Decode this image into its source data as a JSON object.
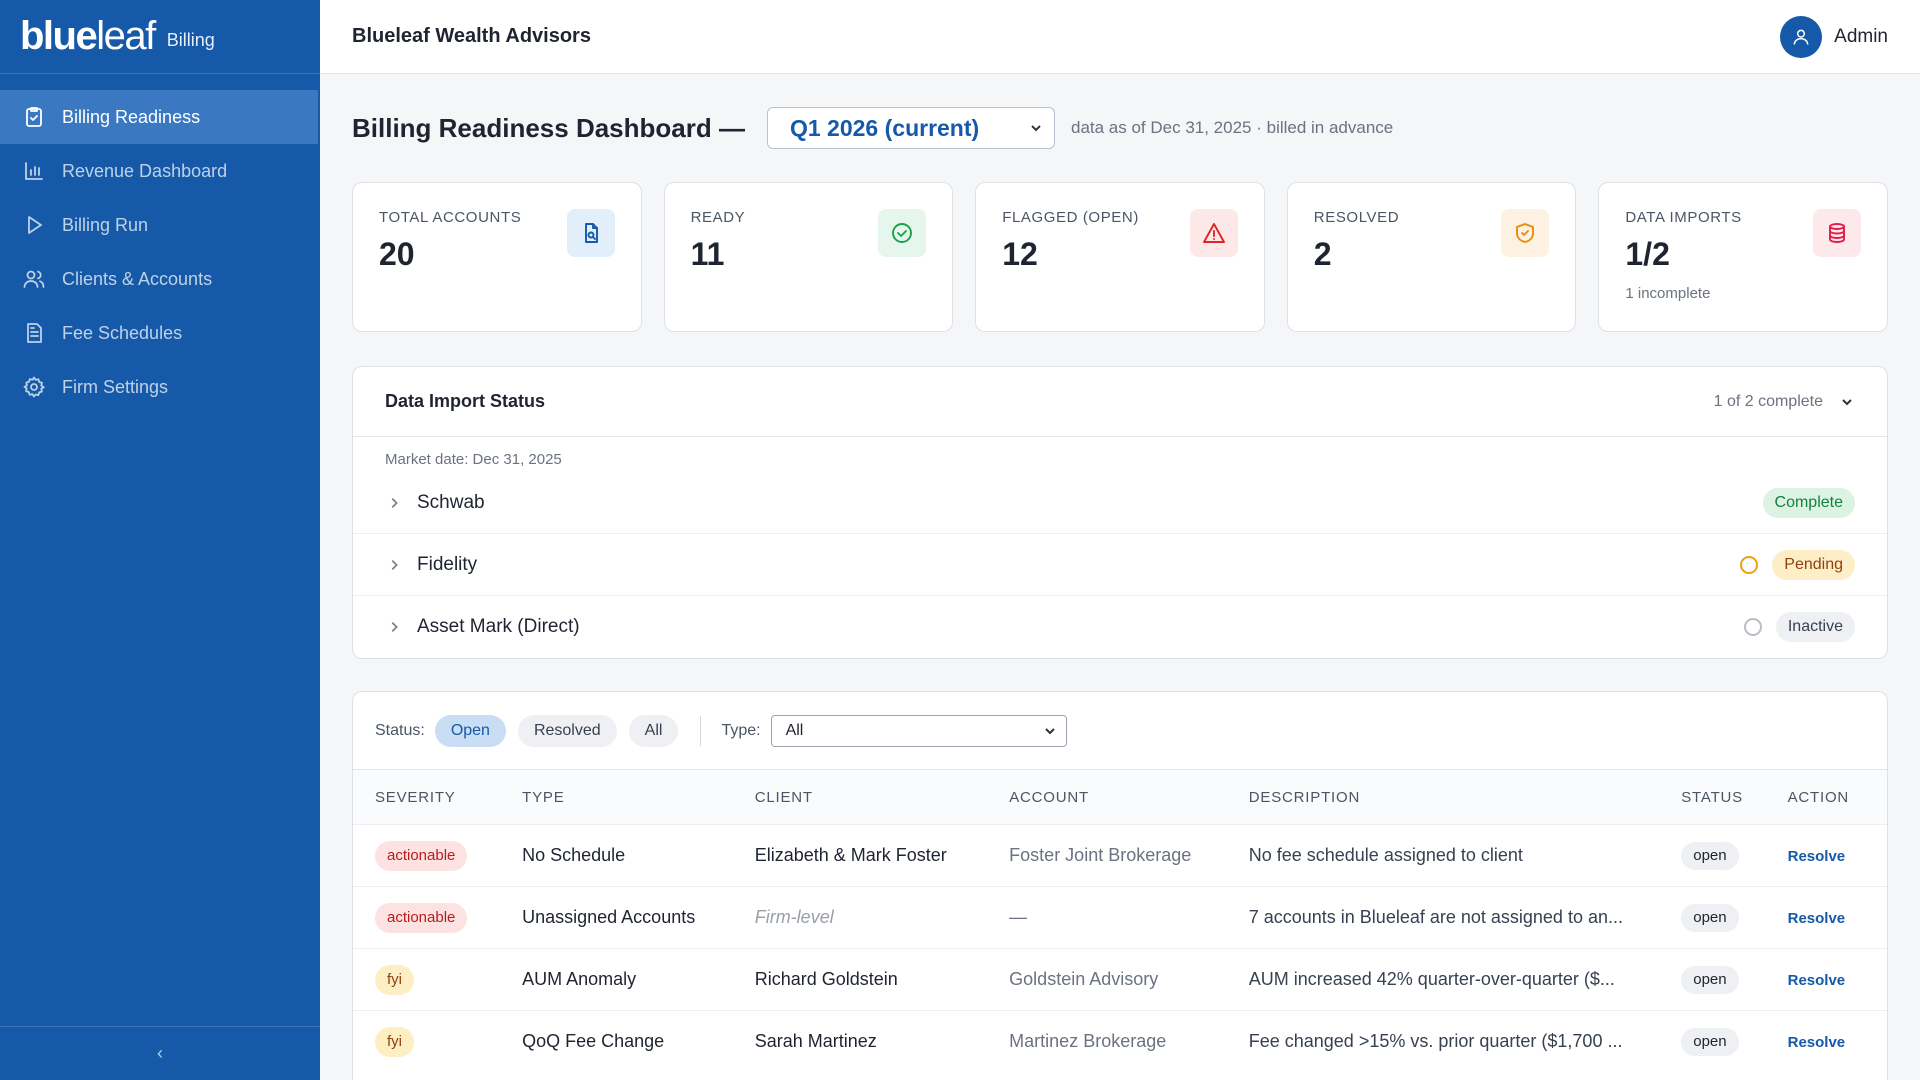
{
  "brand": {
    "logo_text_bold": "blue",
    "logo_text_light": "leaf",
    "product": "Billing"
  },
  "sidebar": {
    "items": [
      {
        "label": "Billing Readiness",
        "icon": "clipboard-check-icon",
        "active": true
      },
      {
        "label": "Revenue Dashboard",
        "icon": "bar-chart-icon",
        "active": false
      },
      {
        "label": "Billing Run",
        "icon": "play-icon",
        "active": false
      },
      {
        "label": "Clients & Accounts",
        "icon": "users-icon",
        "active": false
      },
      {
        "label": "Fee Schedules",
        "icon": "document-icon",
        "active": false
      },
      {
        "label": "Firm Settings",
        "icon": "gear-icon",
        "active": false
      }
    ],
    "collapse_glyph": "‹"
  },
  "header": {
    "firm_name": "Blueleaf Wealth Advisors",
    "user_name": "Admin"
  },
  "page": {
    "title": "Billing Readiness Dashboard —",
    "quarter": "Q1 2026 (current)",
    "data_asof": "data as of Dec 31, 2025 · billed in advance"
  },
  "stats": [
    {
      "label": "TOTAL ACCOUNTS",
      "value": "20",
      "note": "",
      "icon": "document-search-icon",
      "color": "#1559a8",
      "bg": "#e3eefb"
    },
    {
      "label": "READY",
      "value": "11",
      "note": "",
      "icon": "check-circle-icon",
      "color": "#16a34a",
      "bg": "#e6f6ec"
    },
    {
      "label": "FLAGGED (OPEN)",
      "value": "12",
      "note": "",
      "icon": "warning-triangle-icon",
      "color": "#dc2626",
      "bg": "#fde8e8"
    },
    {
      "label": "RESOLVED",
      "value": "2",
      "note": "",
      "icon": "shield-check-icon",
      "color": "#ea8a0c",
      "bg": "#fdf1e1"
    },
    {
      "label": "DATA IMPORTS",
      "value": "1/2",
      "note": "1 incomplete",
      "icon": "database-icon",
      "color": "#e11d48",
      "bg": "#fde8ec"
    }
  ],
  "imports": {
    "title": "Data Import Status",
    "summary": "1 of 2 complete",
    "market_date": "Market date: Dec 31, 2025",
    "rows": [
      {
        "name": "Schwab",
        "status": "Complete",
        "ring": "",
        "pill_bg": "#dcf3e4",
        "pill_color": "#15803d"
      },
      {
        "name": "Fidelity",
        "status": "Pending",
        "ring": "#f59e0b",
        "pill_bg": "#fdeec8",
        "pill_color": "#92400e"
      },
      {
        "name": "Asset Mark (Direct)",
        "status": "Inactive",
        "ring": "#b8bec6",
        "pill_bg": "#eef0f3",
        "pill_color": "#374151"
      }
    ]
  },
  "filters": {
    "status_label": "Status:",
    "status_options": [
      "Open",
      "Resolved",
      "All"
    ],
    "status_selected": "Open",
    "type_label": "Type:",
    "type_value": "All"
  },
  "table": {
    "headers": [
      "SEVERITY",
      "TYPE",
      "CLIENT",
      "ACCOUNT",
      "DESCRIPTION",
      "STATUS",
      "ACTION"
    ],
    "rows": [
      {
        "severity": "actionable",
        "type": "No Schedule",
        "client": "Elizabeth & Mark Foster",
        "client_italic": false,
        "account": "Foster Joint Brokerage",
        "description": "No fee schedule assigned to client",
        "status": "open",
        "action": "Resolve"
      },
      {
        "severity": "actionable",
        "type": "Unassigned Accounts",
        "client": "Firm-level",
        "client_italic": true,
        "account": "—",
        "description": "7 accounts in Blueleaf are not assigned to an...",
        "status": "open",
        "action": "Resolve"
      },
      {
        "severity": "fyi",
        "type": "AUM Anomaly",
        "client": "Richard Goldstein",
        "client_italic": false,
        "account": "Goldstein Advisory",
        "description": "AUM increased 42% quarter-over-quarter ($...",
        "status": "open",
        "action": "Resolve"
      },
      {
        "severity": "fyi",
        "type": "QoQ Fee Change",
        "client": "Sarah Martinez",
        "client_italic": false,
        "account": "Martinez Brokerage",
        "description": "Fee changed >15% vs. prior quarter ($1,700 ...",
        "status": "open",
        "action": "Resolve"
      }
    ],
    "severity_colors": {
      "actionable": {
        "bg": "#fde2e2",
        "color": "#b91c1c"
      },
      "fyi": {
        "bg": "#fdefc3",
        "color": "#92400e"
      }
    }
  }
}
